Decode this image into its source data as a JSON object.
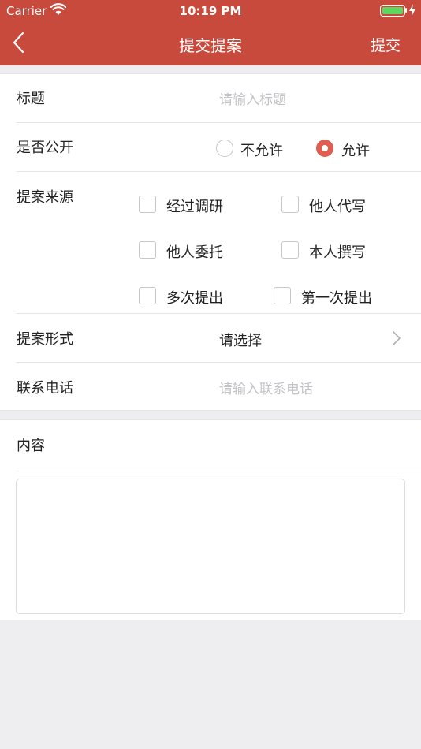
{
  "status_bar": {
    "carrier": "Carrier",
    "time": "10:19 PM"
  },
  "nav": {
    "title": "提交提案",
    "submit_label": "提交"
  },
  "form": {
    "title_label": "标题",
    "title_placeholder": "请输入标题",
    "public_label": "是否公开",
    "public_options": [
      {
        "label": "不允许",
        "selected": false
      },
      {
        "label": "允许",
        "selected": true
      }
    ],
    "source_label": "提案来源",
    "source_options": [
      {
        "label": "经过调研",
        "checked": false
      },
      {
        "label": "他人代写",
        "checked": false
      },
      {
        "label": "他人委托",
        "checked": false
      },
      {
        "label": "本人撰写",
        "checked": false
      },
      {
        "label": "多次提出",
        "checked": false
      },
      {
        "label": "第一次提出",
        "checked": false
      }
    ],
    "format_label": "提案形式",
    "format_value": "请选择",
    "phone_label": "联系电话",
    "phone_placeholder": "请输入联系电话"
  },
  "content": {
    "label": "内容",
    "value": ""
  },
  "colors": {
    "header": "#c84a3c",
    "accent": "#e05d52",
    "background": "#eeeef0"
  }
}
